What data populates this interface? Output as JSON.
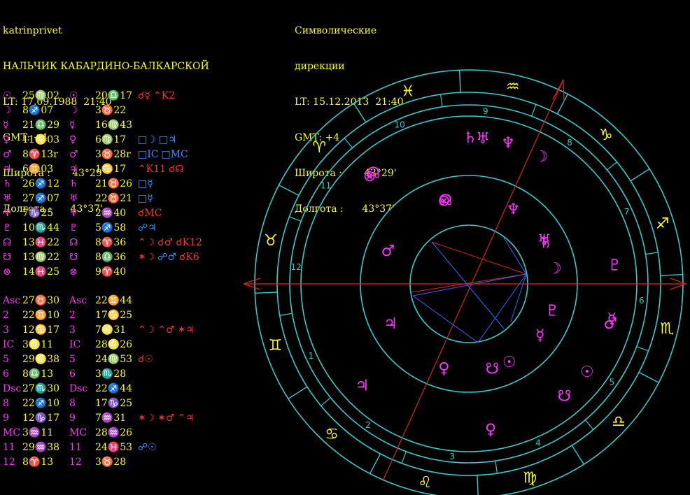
{
  "natal": {
    "lines": [
      "katrinprivet",
      "НАЛЬЧИК КАБАРДИНО-БАЛКАРСКОЙ",
      "LT: 17.09.1988  21:40",
      "GMT: +4",
      "Широта :       43°29'",
      "Долгота :      43°37'"
    ]
  },
  "directed": {
    "lines": [
      "Символические",
      "дирекции",
      "LT: 15.12.2013  21:40",
      "GMT: +4",
      "Широта :       43°29'",
      "Долгота :      43°37'"
    ]
  },
  "planet_rows": [
    {
      "glyph": "☉",
      "natal": "25♍02",
      "dglyph": "☉",
      "dir": "20♎17",
      "aspects": [
        {
          "t": "☌☿",
          "c": "#ff3333"
        },
        {
          "t": "⌃K2",
          "c": "#ff3333"
        }
      ]
    },
    {
      "glyph": "☽",
      "natal": "8♐07",
      "dglyph": "☽",
      "dir": "3♉22",
      "aspects": []
    },
    {
      "glyph": "☿",
      "natal": "21♎29",
      "dglyph": "☿",
      "dir": "16♍43",
      "aspects": []
    },
    {
      "glyph": "♀",
      "natal": "11♌03",
      "dglyph": "♀",
      "dir": "6♍17",
      "aspects": [
        {
          "t": "□☽",
          "c": "#3399ff"
        },
        {
          "t": "□♃",
          "c": "#3399ff"
        }
      ]
    },
    {
      "glyph": "♂",
      "natal": "8♈13r",
      "dglyph": "♂",
      "dir": "3♉28r",
      "aspects": [
        {
          "t": "□IC",
          "c": "#3399ff"
        },
        {
          "t": "□MC",
          "c": "#3399ff"
        }
      ]
    },
    {
      "glyph": "♃",
      "natal": "6♊03",
      "dglyph": "♃",
      "dir": "1♋17",
      "aspects": [
        {
          "t": "⌃K11",
          "c": "#ff3333"
        },
        {
          "t": "☌☊",
          "c": "#ff3333"
        }
      ]
    },
    {
      "glyph": "♄",
      "natal": "26♐12",
      "dglyph": "♄",
      "dir": "21♉26",
      "aspects": [
        {
          "t": "□☿",
          "c": "#3399ff"
        }
      ]
    },
    {
      "glyph": "♅",
      "natal": "27♐07",
      "dglyph": "♅",
      "dir": "22♉21",
      "aspects": [
        {
          "t": "□☿",
          "c": "#3399ff"
        }
      ]
    },
    {
      "glyph": "♆",
      "natal": "7♑25",
      "dglyph": "♆",
      "dir": "2♒40",
      "aspects": [
        {
          "t": "☌MC",
          "c": "#ff3333"
        }
      ]
    },
    {
      "glyph": "♇",
      "natal": "10♏44",
      "dglyph": "♇",
      "dir": "5♐58",
      "aspects": [
        {
          "t": "☍♃",
          "c": "#3399ff"
        }
      ]
    },
    {
      "glyph": "☊",
      "natal": "13♓22",
      "dglyph": "☊",
      "dir": "8♈36",
      "aspects": [
        {
          "t": "⌃☽",
          "c": "#ff3333"
        },
        {
          "t": "☌♂",
          "c": "#ff3333"
        },
        {
          "t": "☌K12",
          "c": "#ff3333"
        }
      ]
    },
    {
      "glyph": "☋",
      "natal": "13♍22",
      "dglyph": "☋",
      "dir": "8♎36",
      "aspects": [
        {
          "t": "✶☽",
          "c": "#ff3333"
        },
        {
          "t": "☍♂",
          "c": "#3399ff"
        },
        {
          "t": "☌K6",
          "c": "#ff3333"
        }
      ]
    },
    {
      "glyph": "⊗",
      "natal": "14♓25",
      "dglyph": "⊗",
      "dir": "9♈40",
      "aspects": []
    }
  ],
  "house_rows": [
    {
      "label": "Asc",
      "natal": "27♉30",
      "dlabel": "Asc",
      "dir": "22♊44",
      "aspects": []
    },
    {
      "label": "2",
      "natal": "22♊10",
      "dlabel": "2",
      "dir": "17♋25",
      "aspects": []
    },
    {
      "label": "3",
      "natal": "12♋17",
      "dlabel": "3",
      "dir": "7♌31",
      "aspects": [
        {
          "t": "⌃☽",
          "c": "#ff3333"
        },
        {
          "t": "⌃♂",
          "c": "#ff3333"
        },
        {
          "t": "✶♃",
          "c": "#ff3333"
        }
      ]
    },
    {
      "label": "IC",
      "natal": "3♌11",
      "dlabel": "IC",
      "dir": "28♌26",
      "aspects": []
    },
    {
      "label": "5",
      "natal": "29♌38",
      "dlabel": "5",
      "dir": "24♍53",
      "aspects": [
        {
          "t": "☌☉",
          "c": "#ff3333"
        }
      ]
    },
    {
      "label": "6",
      "natal": "8♎13",
      "dlabel": "6",
      "dir": "3♏28",
      "aspects": []
    },
    {
      "label": "Dsc",
      "natal": "27♏30",
      "dlabel": "Dsc",
      "dir": "22♐44",
      "aspects": []
    },
    {
      "label": "8",
      "natal": "22♐10",
      "dlabel": "8",
      "dir": "17♑25",
      "aspects": []
    },
    {
      "label": "9",
      "natal": "12♑17",
      "dlabel": "9",
      "dir": "7♒31",
      "aspects": [
        {
          "t": "✶☽",
          "c": "#ff3333"
        },
        {
          "t": "✶♂",
          "c": "#ff3333"
        },
        {
          "t": "⌃♃",
          "c": "#ff3333"
        }
      ]
    },
    {
      "label": "MC",
      "natal": "3♒11",
      "dlabel": "MC",
      "dir": "28♒26",
      "aspects": []
    },
    {
      "label": "11",
      "natal": "29♒38",
      "dlabel": "11",
      "dir": "24♓53",
      "aspects": [
        {
          "t": "☍☉",
          "c": "#3399ff"
        }
      ]
    },
    {
      "label": "12",
      "natal": "8♈13",
      "dlabel": "12",
      "dir": "3♉28",
      "aspects": []
    }
  ],
  "wheel": {
    "zodiac": [
      {
        "glyph": "♓",
        "lon": 345
      },
      {
        "glyph": "♒",
        "lon": 315
      },
      {
        "glyph": "♑",
        "lon": 285
      },
      {
        "glyph": "♐",
        "lon": 255
      },
      {
        "glyph": "♏",
        "lon": 225
      },
      {
        "glyph": "♎",
        "lon": 195
      },
      {
        "glyph": "♍",
        "lon": 165
      },
      {
        "glyph": "♌",
        "lon": 135
      },
      {
        "glyph": "♋",
        "lon": 105
      },
      {
        "glyph": "♊",
        "lon": 75
      },
      {
        "glyph": "♉",
        "lon": 45
      },
      {
        "glyph": "♈",
        "lon": 15
      }
    ],
    "directed_houses": [
      {
        "label": "1",
        "lon": 82
      },
      {
        "label": "2",
        "lon": 112
      },
      {
        "label": "3",
        "lon": 142
      },
      {
        "label": "4",
        "lon": 171
      },
      {
        "label": "5",
        "lon": 203
      },
      {
        "label": "6",
        "lon": 232
      },
      {
        "label": "7",
        "lon": 262
      },
      {
        "label": "8",
        "lon": 292
      },
      {
        "label": "9",
        "lon": 322
      },
      {
        "label": "10",
        "lon": 351
      },
      {
        "label": "11",
        "lon": 23
      },
      {
        "label": "12",
        "lon": 52
      }
    ],
    "directed_planets": [
      {
        "glyph": "♆",
        "lon": 312
      },
      {
        "glyph": "♅",
        "lon": 322
      },
      {
        "glyph": "♄",
        "lon": 327
      },
      {
        "glyph": "☽",
        "lon": 298
      },
      {
        "glyph": "♇",
        "lon": 245
      },
      {
        "glyph": "☿",
        "lon": 224
      },
      {
        "glyph": "♂",
        "lon": 222
      },
      {
        "glyph": "☉",
        "lon": 201
      },
      {
        "glyph": "☋",
        "lon": 188
      },
      {
        "glyph": "♀",
        "lon": 156
      },
      {
        "glyph": "♃",
        "lon": 101
      },
      {
        "glyph": "☊",
        "lon": 8
      },
      {
        "glyph": "⊗",
        "lon": 10
      }
    ],
    "natal_planets": [
      {
        "glyph": "♆",
        "lon": 297
      },
      {
        "glyph": "♅",
        "lon": 268
      },
      {
        "glyph": "♄",
        "lon": 266
      },
      {
        "glyph": "☽",
        "lon": 248
      },
      {
        "glyph": "♇",
        "lon": 220
      },
      {
        "glyph": "☿",
        "lon": 202
      },
      {
        "glyph": "☉",
        "lon": 175
      },
      {
        "glyph": "☋",
        "lon": 163
      },
      {
        "glyph": "♀",
        "lon": 131
      },
      {
        "glyph": "♃",
        "lon": 84
      },
      {
        "glyph": "♂",
        "lon": 35
      },
      {
        "glyph": "☊",
        "lon": 343
      },
      {
        "glyph": "⊗",
        "lon": 344
      }
    ]
  },
  "colors": {
    "text": "#ffff00",
    "glyph": "#ff33ff",
    "ring": "#33cccc",
    "axis": "#dd2222",
    "aspect_blue": "#3366ff"
  }
}
